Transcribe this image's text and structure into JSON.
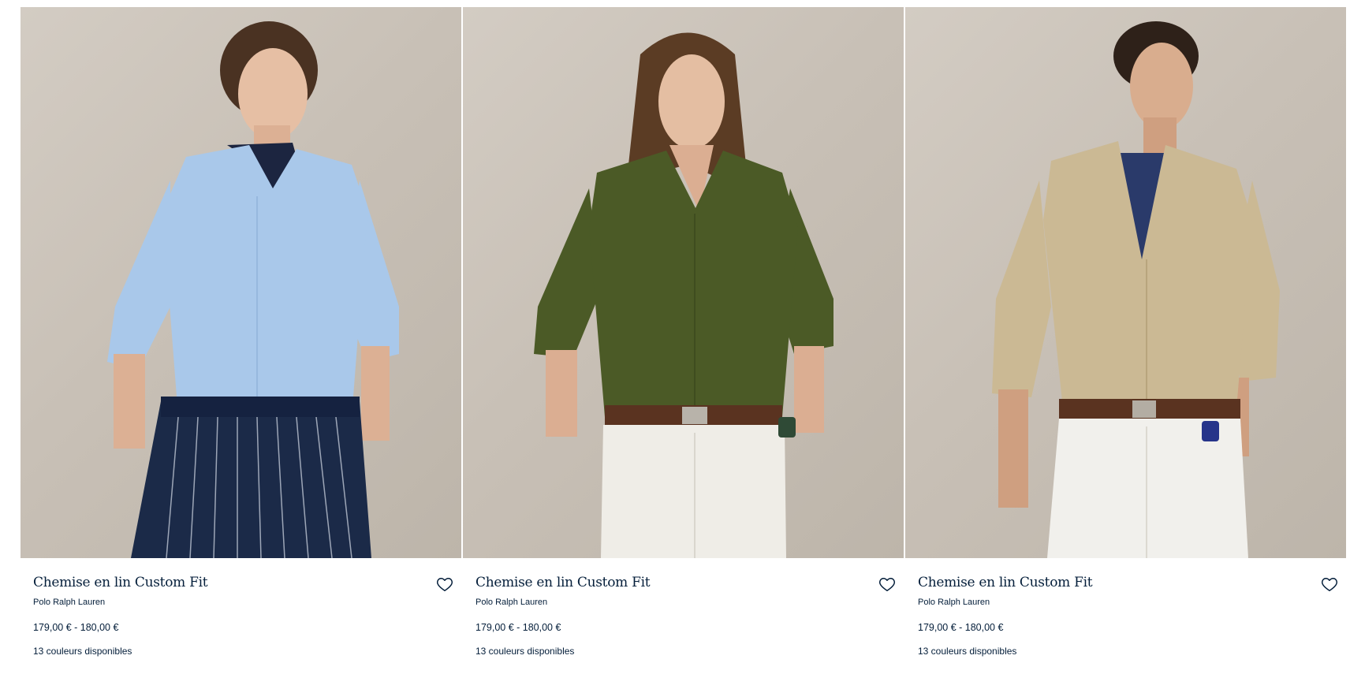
{
  "products": [
    {
      "title": "Chemise en lin Custom Fit",
      "brand": "Polo Ralph Lauren",
      "price": "179,00 € - 180,00 €",
      "colors": "13 couleurs disponibles",
      "shirt_color": "#a9c8ea",
      "pants_color": "#1b2a48",
      "hair_color": "#4a3222"
    },
    {
      "title": "Chemise en lin Custom Fit",
      "brand": "Polo Ralph Lauren",
      "price": "179,00 € - 180,00 €",
      "colors": "13 couleurs disponibles",
      "shirt_color": "#4b5a26",
      "pants_color": "#efede7",
      "hair_color": "#5b3c24"
    },
    {
      "title": "Chemise en lin Custom Fit",
      "brand": "Polo Ralph Lauren",
      "price": "179,00 € - 180,00 €",
      "colors": "13 couleurs disponibles",
      "shirt_color": "#cbb994",
      "pants_color": "#f1f0ec",
      "hair_color": "#2e2119"
    }
  ],
  "icons": {
    "wishlist": "heart-outline-icon"
  }
}
